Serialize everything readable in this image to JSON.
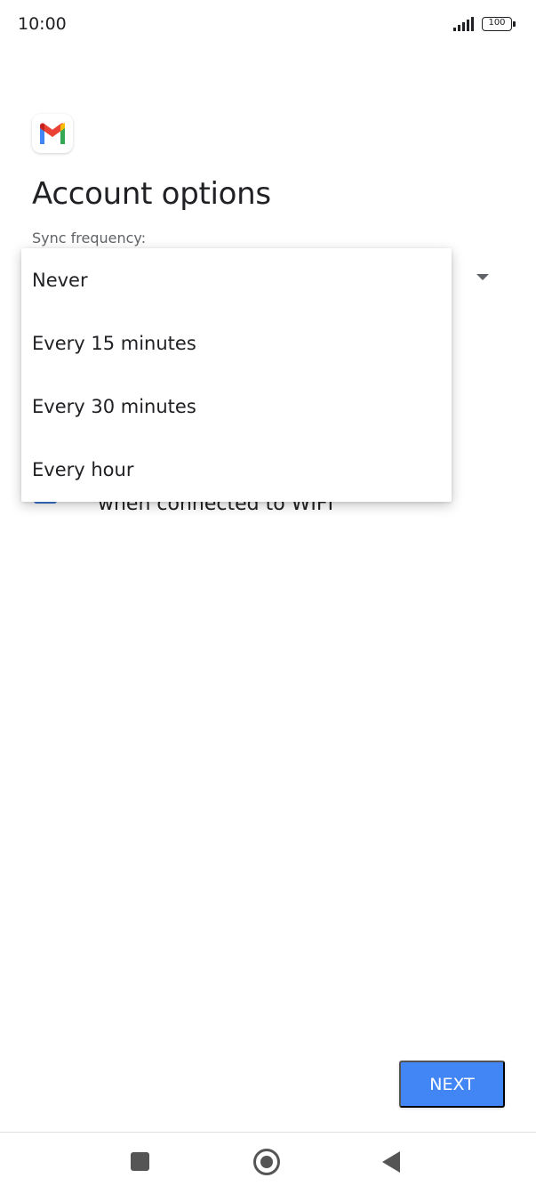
{
  "status_bar": {
    "time": "10:00",
    "battery": "100",
    "icons": [
      "signal-icon",
      "battery-icon"
    ]
  },
  "app": {
    "logo": "gmail-logo",
    "colors": {
      "blue": "#4285F4",
      "red": "#EA4335",
      "yellow": "#FBBC04",
      "green": "#34A853"
    }
  },
  "page": {
    "title": "Account options",
    "sync_label": "Sync frequency:",
    "checkbox_label": "when connected to WIFI"
  },
  "dropdown": {
    "options": [
      "Never",
      "Every 15 minutes",
      "Every 30 minutes",
      "Every hour"
    ]
  },
  "actions": {
    "next_label": "NEXT",
    "accent_color": "#4285F4"
  },
  "navigation": {
    "icons": [
      "recent-apps-icon",
      "home-icon",
      "back-icon"
    ]
  }
}
